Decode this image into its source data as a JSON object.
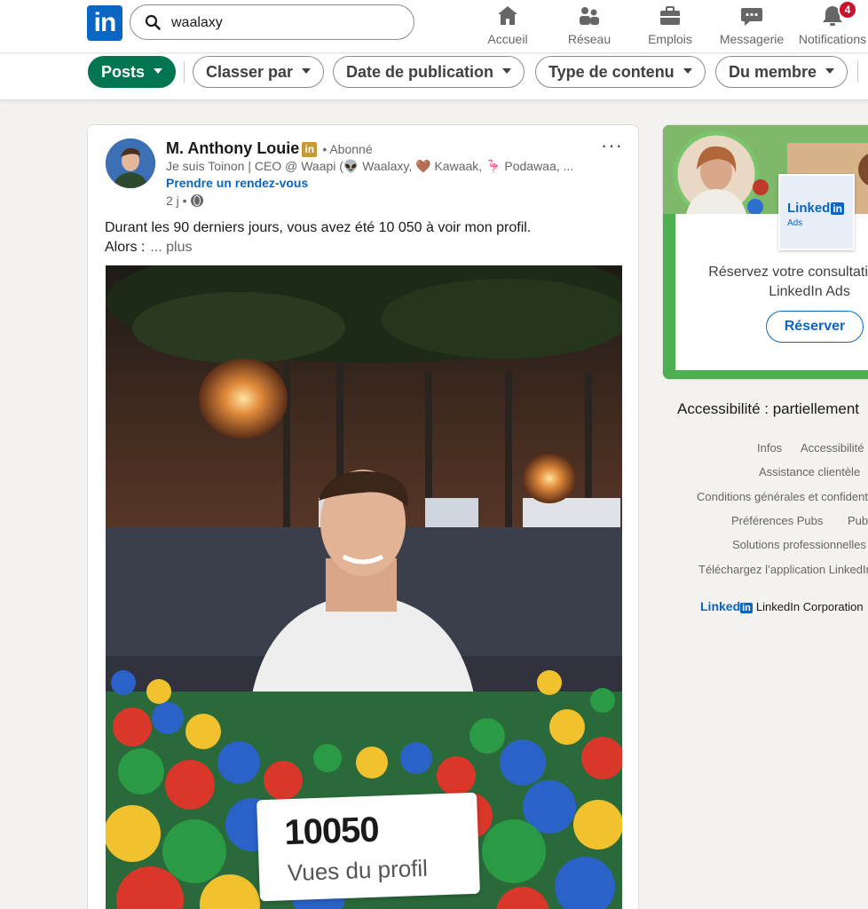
{
  "nav": {
    "logo": "in",
    "search_value": "waalaxy",
    "items": [
      {
        "label": "Accueil",
        "icon": "home-icon"
      },
      {
        "label": "Réseau",
        "icon": "network-icon"
      },
      {
        "label": "Emplois",
        "icon": "briefcase-icon"
      },
      {
        "label": "Messagerie",
        "icon": "messaging-icon"
      },
      {
        "label": "Notifications",
        "icon": "bell-icon",
        "badge": "4"
      }
    ]
  },
  "filters": [
    "Posts",
    "Classer par",
    "Date de publication",
    "Type de contenu",
    "Du membre"
  ],
  "post": {
    "author": "M. Anthony Louie",
    "author_badge": "in",
    "follow_status": "• Abonné",
    "headline": "Je suis Toinon | CEO @ Waapi (👽 Waalaxy, 🤎 Kawaak, 🦩 Podawaa, ...",
    "cta": "Prendre un rendez-vous",
    "time": "2 j •",
    "more_menu": "···",
    "text_line1": "Durant les 90 derniers jours, vous avez été 10 050 à voir mon profil.",
    "text_line2": "Alors :",
    "more_label": "... plus",
    "stat_number": "10050",
    "stat_label": "Vues du profil"
  },
  "ad": {
    "logo_text": "Linked",
    "logo_in": "in",
    "logo_sub": "Ads",
    "text_line1": "Réservez votre consultation",
    "text_line2": "LinkedIn Ads",
    "button": "Réserver"
  },
  "footer": {
    "accessibility": "Accessibilité : partiellement",
    "links": [
      "Infos",
      "Accessibilité",
      "Assistance clientèle",
      "Conditions générales et confidentialité",
      "Préférences Pubs",
      "Publicité",
      "Solutions professionnelles",
      "Téléchargez l’application LinkedIn"
    ],
    "brand_text": "Linked",
    "brand_in": "in",
    "corporation": "LinkedIn Corporation"
  },
  "colors": {
    "linkedin_blue": "#0a66c2",
    "active_filter": "#01754f",
    "badge_red": "#cb112d",
    "premium_gold": "#c79a33"
  }
}
